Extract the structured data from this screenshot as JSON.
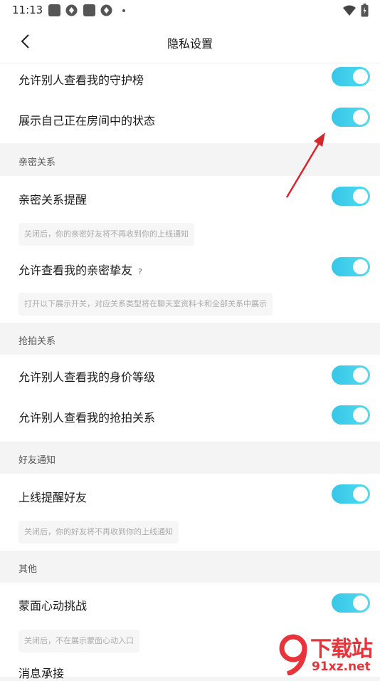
{
  "status_bar": {
    "time": "11:13"
  },
  "header": {
    "title": "隐私设置"
  },
  "rows": {
    "guard_list": "允许别人查看我的守护榜",
    "room_status": "展示自己正在房间中的状态",
    "intimate_reminder": "亲密关系提醒",
    "view_intimate_friends": "允许查看我的亲密挚友",
    "view_value_level": "允许别人查看我的身价等级",
    "view_grab_relation": "允许别人查看我的抢拍关系",
    "online_reminder": "上线提醒好友",
    "masked_heartbeat": "蒙面心动挑战",
    "message_relay": "消息承接"
  },
  "sections": {
    "intimate": "亲密关系",
    "grab": "抢拍关系",
    "friend_notify": "好友通知",
    "other": "其他"
  },
  "hints": {
    "intimate_reminder": "关闭后，你的亲密好友将不再收到你的上线通知",
    "intimate_friends": "打开以下展示开关，对应关系类型将在聊天室资料卡和全部关系中展示",
    "online_reminder": "关闭后，你的好友将不再收到你的上线通知",
    "masked_heartbeat": "关闭后，不在展示蒙面心动入口"
  },
  "help_mark": "?",
  "toggles_on": {
    "guard_list": true,
    "room_status": true,
    "intimate_reminder": true,
    "view_intimate_friends": true,
    "view_value_level": true,
    "view_grab_relation": true,
    "online_reminder": true,
    "masked_heartbeat": true
  },
  "colors": {
    "toggle_on": "#38c6e8",
    "annotation_arrow": "#d9262c",
    "watermark": "#e8333b"
  },
  "watermark": {
    "big": "下载站",
    "url": "91xz.net"
  }
}
